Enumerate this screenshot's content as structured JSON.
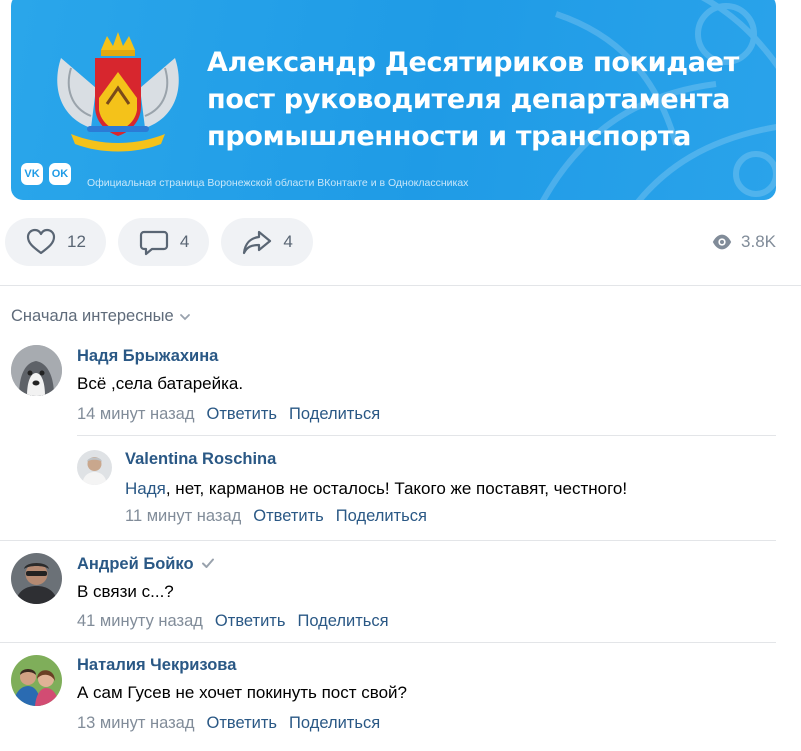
{
  "banner": {
    "headline_lines": [
      "Александр Десятириков покидает",
      "пост руководителя департамента",
      "промышленности и транспорта"
    ],
    "vk_icon": "VK",
    "ok_icon": "OK",
    "footer": "Официальная страница Воронежской области ВКонтакте и в Одноклассниках"
  },
  "actions": {
    "likes": "12",
    "comments": "4",
    "shares": "4",
    "views": "3.8K"
  },
  "sort_label": "Сначала интересные",
  "comments": [
    {
      "author": "Надя Брыжахина",
      "text": "Всё ,села батарейка.",
      "time": "14 минут назад",
      "reply": "Ответить",
      "share": "Поделиться",
      "replies": [
        {
          "author": "Valentina Roschina",
          "mention": "Надя",
          "text": ", нет, карманов не осталось! Такого же поставят, честного!",
          "time": "11 минут назад",
          "reply": "Ответить",
          "share": "Поделиться"
        }
      ]
    },
    {
      "author": "Андрей Бойко",
      "text": "В связи с...?",
      "time": "41 минуту назад",
      "reply": "Ответить",
      "share": "Поделиться"
    },
    {
      "author": "Наталия Чекризова",
      "text": "А сам Гусев не хочет покинуть пост свой?",
      "time": "13 минут назад",
      "reply": "Ответить",
      "share": "Поделиться"
    }
  ]
}
